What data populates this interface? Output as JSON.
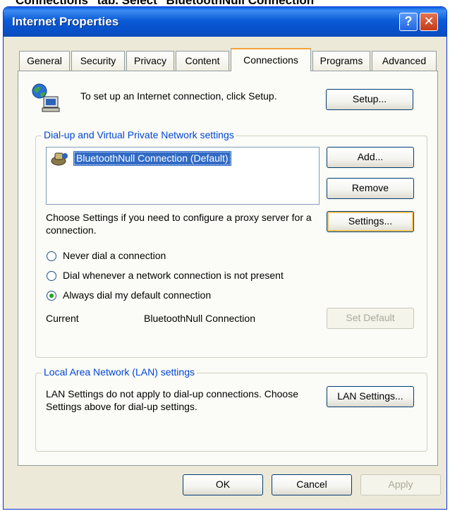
{
  "doc_caption": "Connections\" tab. Select \"BluetoothNull Connection\"",
  "window": {
    "title": "Internet Properties",
    "help_glyph": "?",
    "close_glyph": "✕"
  },
  "tabs": [
    {
      "label": "General"
    },
    {
      "label": "Security"
    },
    {
      "label": "Privacy"
    },
    {
      "label": "Content"
    },
    {
      "label": "Connections",
      "active": true
    },
    {
      "label": "Programs"
    },
    {
      "label": "Advanced"
    }
  ],
  "setup": {
    "text": "To set up an Internet connection, click Setup.",
    "button": "Setup..."
  },
  "dialup": {
    "group_label": "Dial-up and Virtual Private Network settings",
    "connections": [
      "BluetoothNull Connection (Default)"
    ],
    "add_button": "Add...",
    "remove_button": "Remove",
    "settings_text": "Choose Settings if you need to configure a proxy server for a connection.",
    "settings_button": "Settings...",
    "radio_options": [
      {
        "label": "Never dial a connection",
        "checked": false
      },
      {
        "label": "Dial whenever a network connection is not present",
        "checked": false
      },
      {
        "label": "Always dial my default connection",
        "checked": true
      }
    ],
    "current_label": "Current",
    "current_value": "BluetoothNull Connection",
    "set_default_button": "Set Default"
  },
  "lan": {
    "group_label": "Local Area Network (LAN) settings",
    "text": "LAN Settings do not apply to dial-up connections. Choose Settings above for dial-up settings.",
    "button": "LAN Settings..."
  },
  "footer": {
    "ok": "OK",
    "cancel": "Cancel",
    "apply": "Apply"
  },
  "colors": {
    "title_bar": "#0b5bd7",
    "group_label": "#0046d5",
    "selection": "#316ac5",
    "active_tab_accent": "#f6a23a"
  }
}
